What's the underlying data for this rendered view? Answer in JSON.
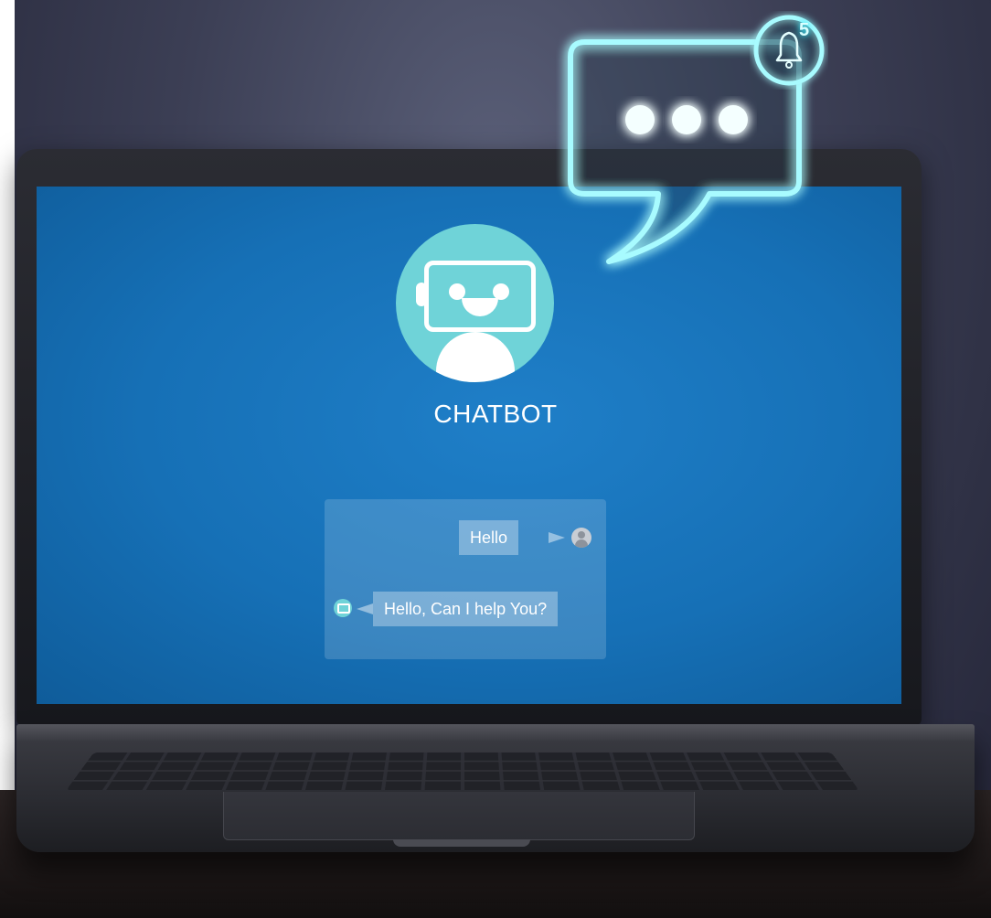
{
  "screen": {
    "bot_title": "CHATBOT",
    "bot_avatar_icon": "robot-icon",
    "messages": [
      {
        "sender": "user",
        "text": "Hello",
        "avatar_icon": "user-avatar-icon"
      },
      {
        "sender": "bot",
        "text": "Hello, Can I help You?",
        "avatar_icon": "bot-avatar-icon"
      }
    ]
  },
  "overlay": {
    "typing_indicator_icon": "typing-dots-icon",
    "notification": {
      "icon": "bell-icon",
      "count": "5"
    }
  },
  "colors": {
    "screen_bg": "#1670b6",
    "bot_accent": "#6fd3d8",
    "neon_glow": "#3ff0ff"
  }
}
